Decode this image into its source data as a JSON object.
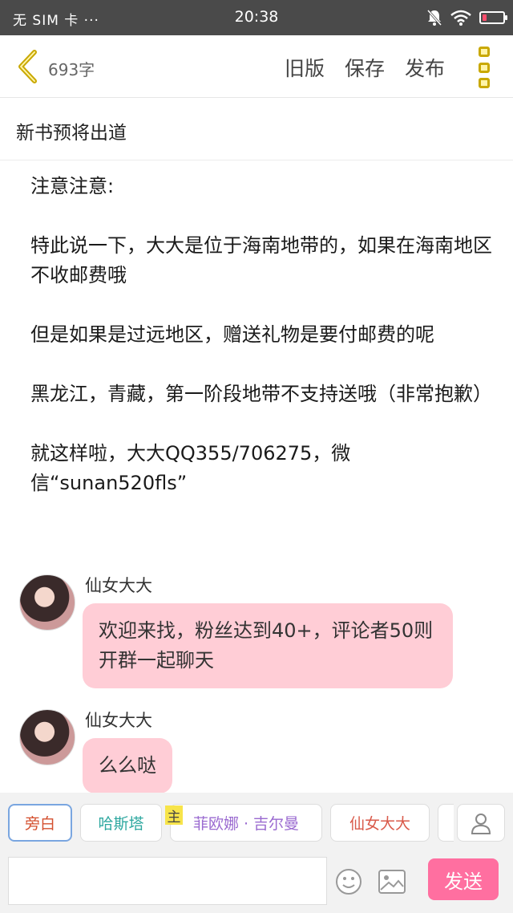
{
  "status_bar": {
    "carrier": "无 SIM 卡 ···",
    "time": "20:38",
    "battery_level": 0.2
  },
  "toolbar": {
    "back_icon": "chevron-left-icon",
    "word_count": "693字",
    "old_version": "旧版",
    "save": "保存",
    "publish": "发布",
    "more_icon": "more-vertical-icon"
  },
  "title": "新书预将出道",
  "content": {
    "paragraphs": [
      "注意注意:",
      "特此说一下，大大是位于海南地带的，如果在海南地区不收邮费哦",
      "但是如果是过远地区，赠送礼物是要付邮费的呢",
      "黑龙江，青藏，第一阶段地带不支持送哦（非常抱歉）",
      "就这样啦，大大QQ355/706275，微信“sunan520fls”"
    ]
  },
  "chat": [
    {
      "sender": "仙女大大",
      "message": "欢迎来找，粉丝达到40+，评论者50则开群一起聊天"
    },
    {
      "sender": "仙女大大",
      "message": "么么哒"
    }
  ],
  "bottom_bar": {
    "roles": [
      "旁白",
      "哈斯塔",
      "菲欧娜 · 吉尔曼",
      "仙女大大"
    ],
    "host_badge": "主",
    "send": "发送",
    "input_placeholder": ""
  },
  "colors": {
    "accent_pink": "#ff6fa0",
    "bubble_pink": "#ffcdd6",
    "icon_yellow": "#c9a800",
    "status_bar": "#4a4a4a"
  }
}
